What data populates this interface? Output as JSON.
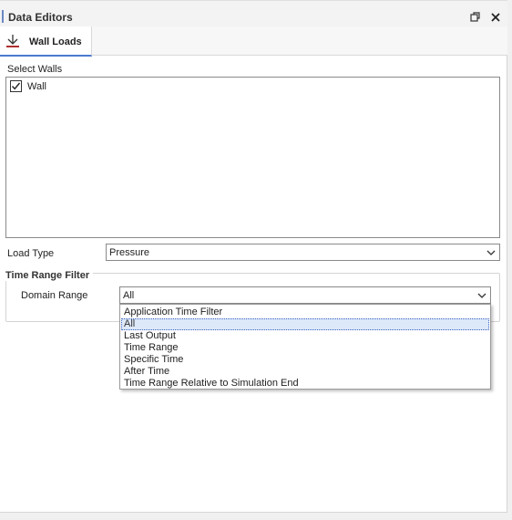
{
  "window": {
    "title": "Data Editors"
  },
  "tabs": [
    {
      "label": "Wall Loads",
      "icon": "wall-load-icon"
    }
  ],
  "select_walls": {
    "label": "Select Walls",
    "items": [
      {
        "label": "Wall",
        "checked": true
      }
    ]
  },
  "load_type": {
    "label": "Load Type",
    "value": "Pressure"
  },
  "time_range_filter": {
    "title": "Time Range Filter",
    "domain_range": {
      "label": "Domain Range",
      "value": "All",
      "options": [
        "Application Time Filter",
        "All",
        "Last Output",
        "Time Range",
        "Specific Time",
        "After Time",
        "Time Range Relative to Simulation End"
      ],
      "selected_index": 1
    }
  },
  "colors": {
    "accent": "#4a7bd0",
    "selection": "#dde8f8",
    "icon_red": "#b03030"
  }
}
